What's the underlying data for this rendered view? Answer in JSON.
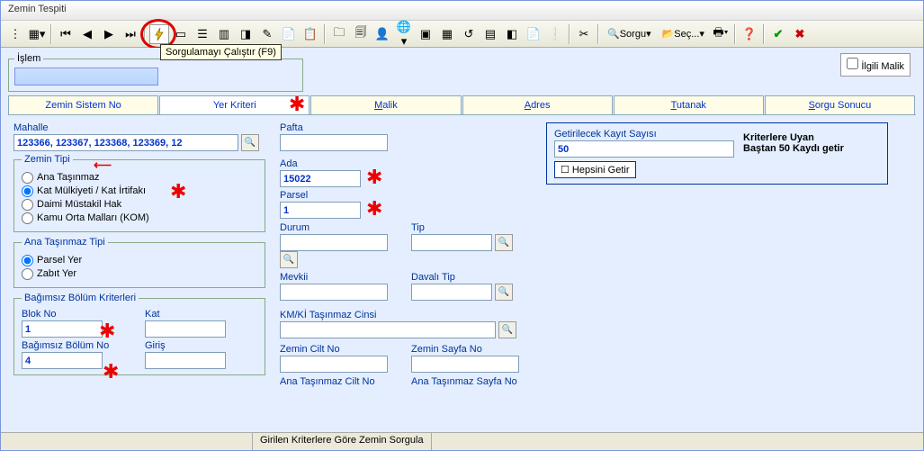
{
  "window": {
    "title": "Zemin Tespiti"
  },
  "toolbar": {
    "run_tooltip": "Sorgulamayı Çalıştır  (F9)",
    "labels": {
      "sorgu": "Sorgu",
      "sec": "Seç..."
    }
  },
  "islem": {
    "legend": "İşlem",
    "value": ""
  },
  "ilgili_malik": "İlgili Malik",
  "tabs": {
    "t1": "Zemin Sistem No",
    "t2": "Yer Kriteri",
    "t3_m": "M",
    "t3_rest": "alik",
    "t4_a": "A",
    "t4_rest": "dres",
    "t5_t": "T",
    "t5_rest": "utanak",
    "t6_s": "S",
    "t6_rest": "orgu Sonucu"
  },
  "mahalle": {
    "label": "Mahalle",
    "value": "123366, 123367, 123368, 123369, 12"
  },
  "zemin_tipi": {
    "legend": "Zemin Tipi",
    "r1": "Ana Taşınmaz",
    "r2": "Kat Mülkiyeti / Kat İrtifakı",
    "r3": "Daimi Müstakil Hak",
    "r4": "Kamu Orta Malları (KOM)"
  },
  "ana_tasinmaz_tipi": {
    "legend": "Ana Taşınmaz Tipi",
    "r1": "Parsel Yer",
    "r2": "Zabıt Yer"
  },
  "bagimsiz": {
    "legend": "Bağımsız Bölüm Kriterleri",
    "blok_no_label": "Blok No",
    "blok_no": "1",
    "kat_label": "Kat",
    "kat": "",
    "bb_no_label": "Bağımsız Bölüm No",
    "bb_no": "4",
    "giris_label": "Giriş",
    "giris": ""
  },
  "col2": {
    "pafta_label": "Pafta",
    "pafta": "",
    "ada_label": "Ada",
    "ada": "15022",
    "parsel_label": "Parsel",
    "parsel": "1",
    "durum_label": "Durum",
    "durum": "",
    "tip_label": "Tip",
    "tip": "",
    "mevkii_label": "Mevkii",
    "mevkii": "",
    "davali_tip_label": "Davalı Tip",
    "davali_tip": "",
    "kmki_label": "KM/Kİ Taşınmaz Cinsi",
    "kmki": "",
    "zcilt_label": "Zemin Cilt No",
    "zcilt": "",
    "zsayfa_label": "Zemin Sayfa No",
    "zsayfa": "",
    "acilt_label": "Ana Taşınmaz Cilt No",
    "asayfa_label": "Ana Taşınmaz Sayfa No"
  },
  "getir": {
    "label": "Getirilecek Kayıt Sayısı",
    "value": "50",
    "hepsi": "Hepsini Getir",
    "desc1": "Kriterlere Uyan",
    "desc2": "Baştan 50 Kaydı getir"
  },
  "status": {
    "text": "Girilen Kriterlere Göre Zemin Sorgula"
  }
}
